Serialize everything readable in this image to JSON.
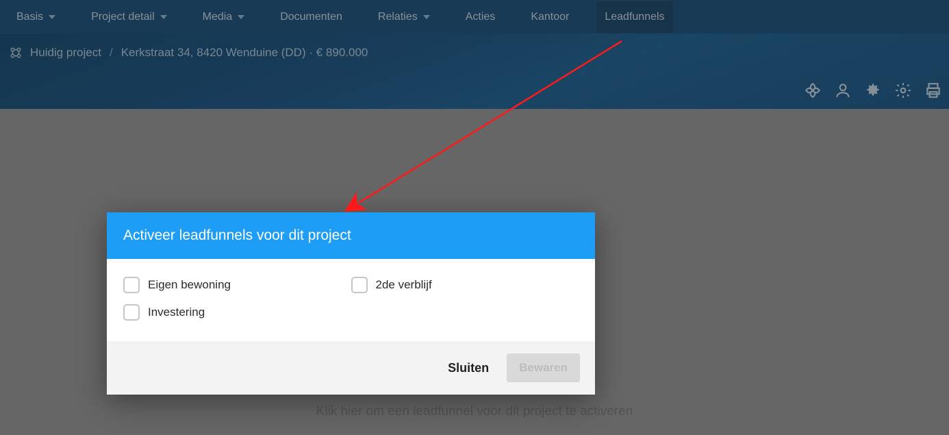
{
  "nav": {
    "items": [
      {
        "label": "Basis",
        "dropdown": true,
        "active": false
      },
      {
        "label": "Project detail",
        "dropdown": true,
        "active": false
      },
      {
        "label": "Media",
        "dropdown": true,
        "active": false
      },
      {
        "label": "Documenten",
        "dropdown": false,
        "active": false
      },
      {
        "label": "Relaties",
        "dropdown": true,
        "active": false
      },
      {
        "label": "Acties",
        "dropdown": false,
        "active": false
      },
      {
        "label": "Kantoor",
        "dropdown": false,
        "active": false
      },
      {
        "label": "Leadfunnels",
        "dropdown": false,
        "active": true
      }
    ]
  },
  "breadcrumb": {
    "root": "Huidig project",
    "detail": "Kerkstraat 34, 8420 Wenduine (DD) · € 890.000"
  },
  "toolbar": {
    "icons": [
      "swirl-icon",
      "person-icon",
      "burst-icon",
      "gear-icon",
      "print-icon"
    ]
  },
  "hint": "Klik hier om een leadfunnel voor dit project te activeren",
  "modal": {
    "title": "Activeer leadfunnels voor dit project",
    "options": [
      {
        "label": "Eigen bewoning"
      },
      {
        "label": "2de verblijf"
      },
      {
        "label": "Investering"
      }
    ],
    "close_label": "Sluiten",
    "save_label": "Bewaren"
  },
  "colors": {
    "accent_blue": "#1e9df7",
    "nav_dark": "#0c4a7b"
  }
}
